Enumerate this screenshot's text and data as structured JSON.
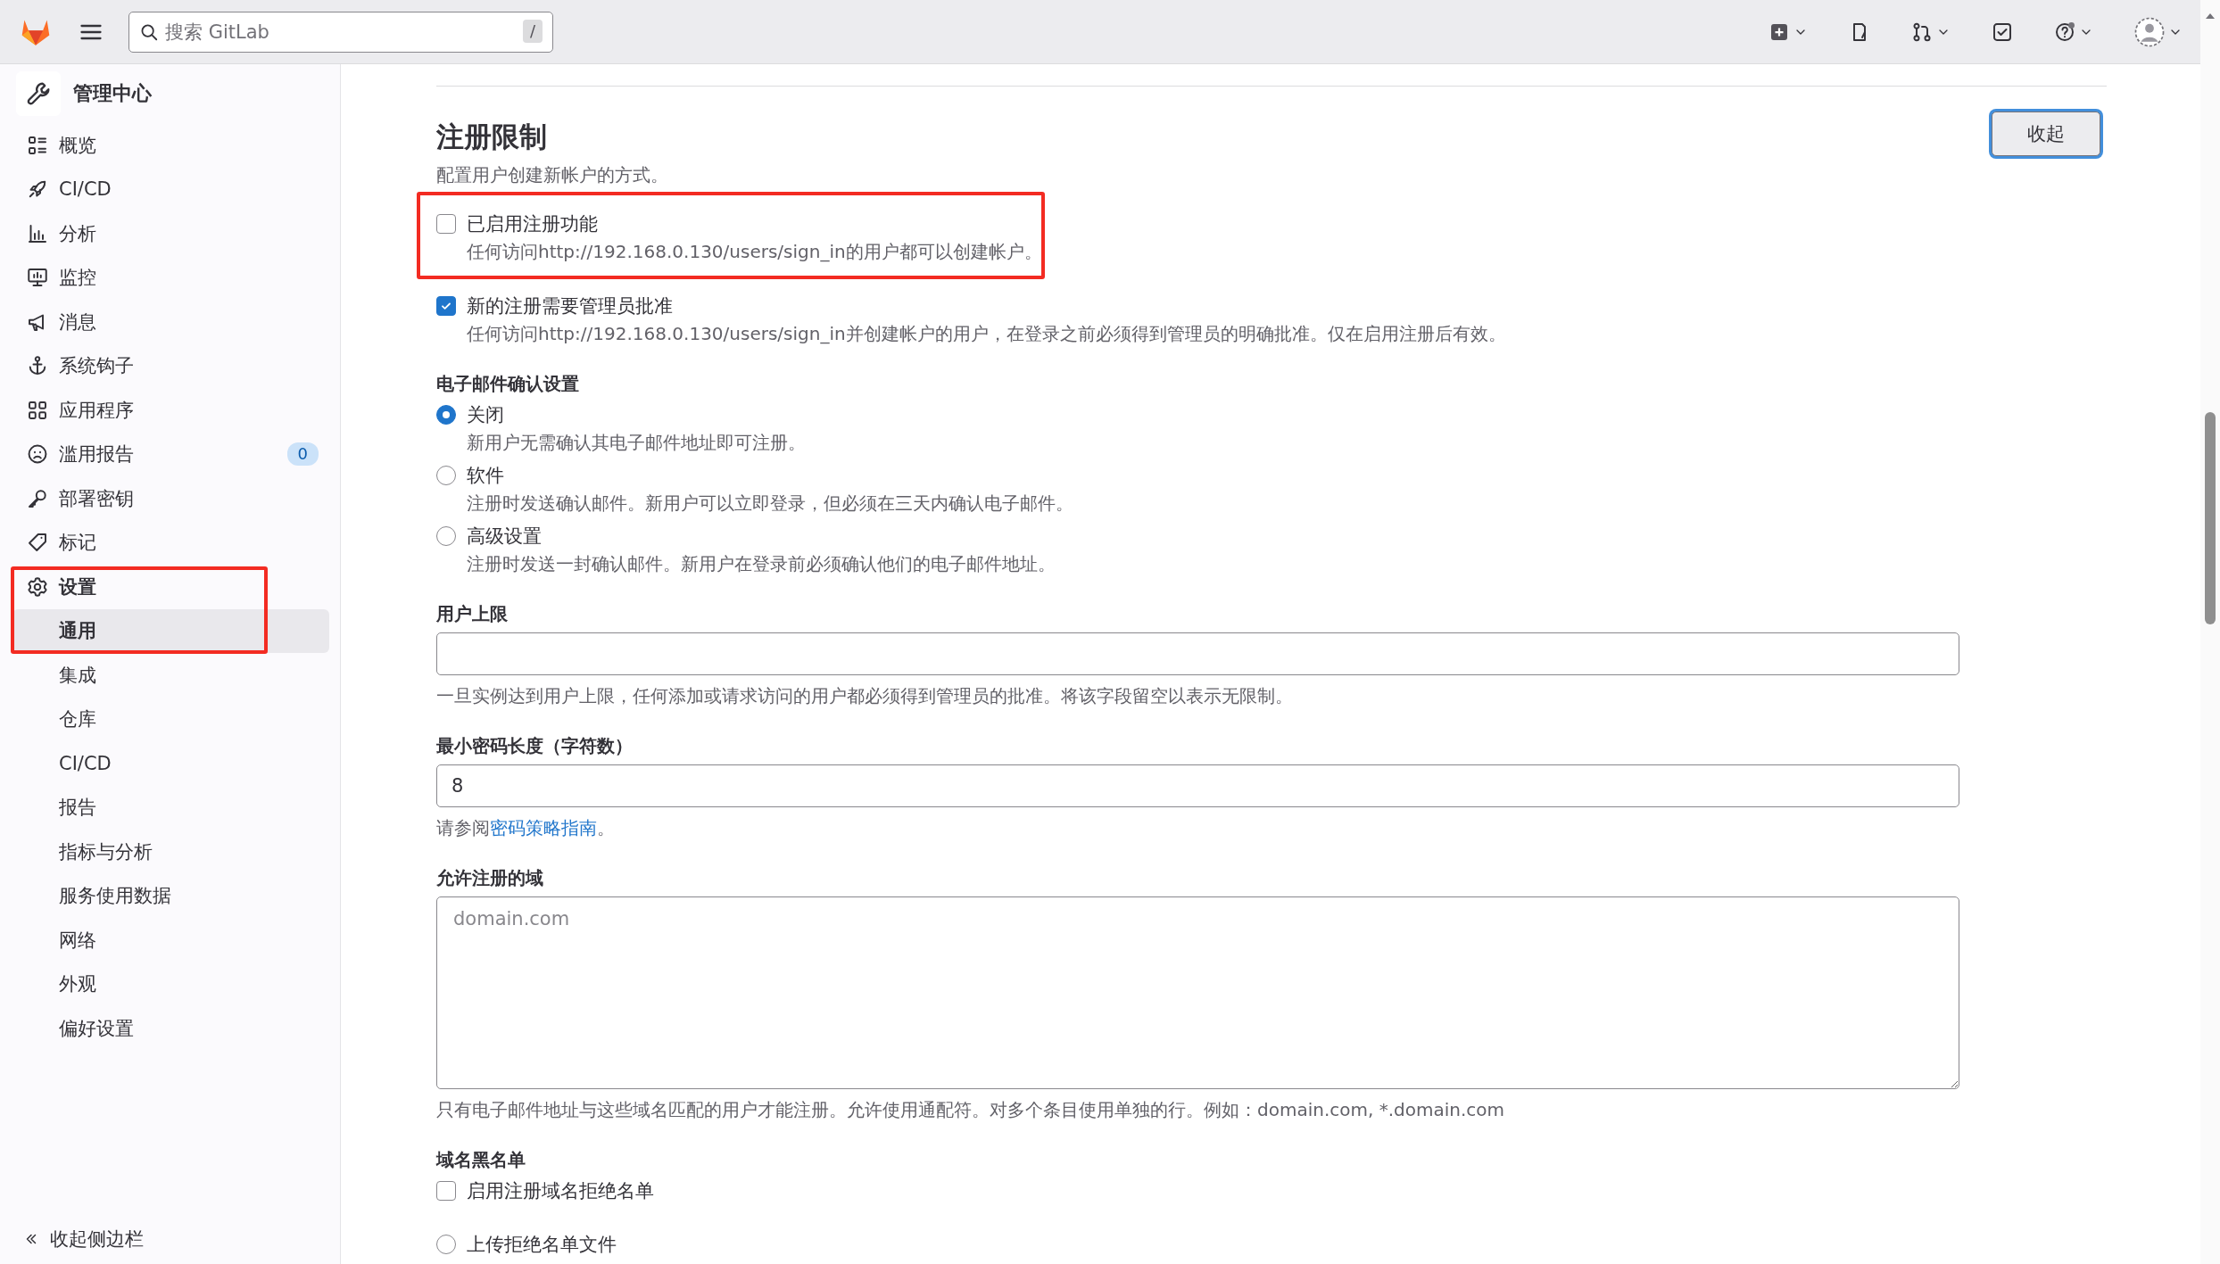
{
  "top_bar": {
    "search": {
      "placeholder": "搜索 GitLab",
      "shortcut": "/"
    }
  },
  "sidebar": {
    "title": "管理中心",
    "items": [
      {
        "label": "概览",
        "selected": false
      },
      {
        "label": "CI/CD",
        "selected": false
      },
      {
        "label": "分析",
        "selected": false
      },
      {
        "label": "监控",
        "selected": false
      },
      {
        "label": "消息",
        "selected": false
      },
      {
        "label": "系统钩子",
        "selected": false
      },
      {
        "label": "应用程序",
        "selected": false
      },
      {
        "label": "滥用报告",
        "badge": "0",
        "selected": false
      },
      {
        "label": "部署密钥",
        "selected": false
      },
      {
        "label": "标记",
        "selected": false
      },
      {
        "label": "设置",
        "selected": false,
        "expanded": true,
        "highlighted": true,
        "children": [
          {
            "label": "通用",
            "selected": true
          },
          {
            "label": "集成",
            "selected": false
          },
          {
            "label": "仓库",
            "selected": false
          },
          {
            "label": "CI/CD",
            "selected": false
          },
          {
            "label": "报告",
            "selected": false
          },
          {
            "label": "指标与分析",
            "selected": false
          },
          {
            "label": "服务使用数据",
            "selected": false
          },
          {
            "label": "网络",
            "selected": false
          },
          {
            "label": "外观",
            "selected": false
          },
          {
            "label": "偏好设置",
            "selected": false
          }
        ]
      }
    ],
    "collapse": "收起侧边栏"
  },
  "section": {
    "title": "注册限制",
    "description": "配置用户创建新帐户的方式。",
    "collapse_button": "收起"
  },
  "registration_options": [
    {
      "label": "已启用注册功能",
      "help": "任何访问http://192.168.0.130/users/sign_in的用户都可以创建帐户。",
      "checked": false,
      "highlighted": true
    },
    {
      "label": "新的注册需要管理员批准",
      "help": "任何访问http://192.168.0.130/users/sign_in并创建帐户的用户，在登录之前必须得到管理员的明确批准。仅在启用注册后有效。",
      "checked": true,
      "highlighted": false
    }
  ],
  "email_confirmation": {
    "label": "电子邮件确认设置",
    "options": [
      {
        "label": "关闭",
        "help": "新用户无需确认其电子邮件地址即可注册。",
        "selected": true
      },
      {
        "label": "软件",
        "help": "注册时发送确认邮件。新用户可以立即登录，但必须在三天内确认电子邮件。",
        "selected": false
      },
      {
        "label": "高级设置",
        "help": "注册时发送一封确认邮件。新用户在登录前必须确认他们的电子邮件地址。",
        "selected": false
      }
    ]
  },
  "user_cap": {
    "label": "用户上限",
    "help": "一旦实例达到用户上限，任何添加或请求访问的用户都必须得到管理员的批准。将该字段留空以表示无限制。"
  },
  "min_password_length": {
    "label": "最小密码长度（字符数）",
    "value": "8",
    "help_prefix": "请参阅",
    "help_link": "密码策略指南",
    "help_suffix": "。"
  },
  "allowed_domains": {
    "label": "允许注册的域",
    "placeholder": "domain.com",
    "help": "只有电子邮件地址与这些域名匹配的用户才能注册。允许使用通配符。对多个条目使用单独的行。例如：domain.com, *.domain.com"
  },
  "domain_denylist": {
    "label": "域名黑名单",
    "options": [
      {
        "kind": "checkbox",
        "label": "启用注册域名拒绝名单",
        "checked": false
      },
      {
        "kind": "radio",
        "label": "上传拒绝名单文件",
        "selected": false
      }
    ]
  }
}
